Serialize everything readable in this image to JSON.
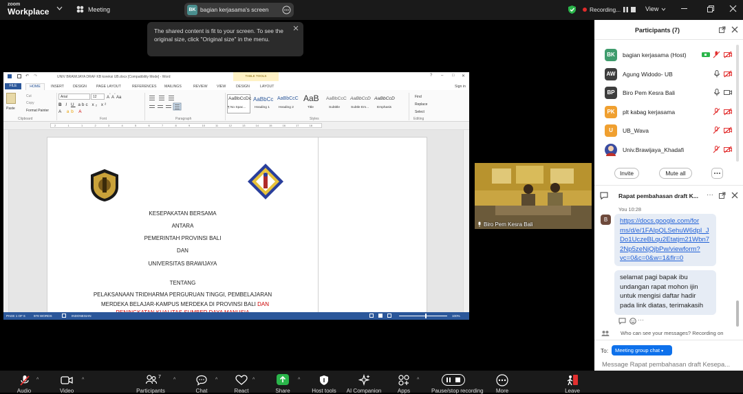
{
  "app": {
    "logo_line1": "zoom",
    "logo_line2": "Workplace",
    "meeting_label": "Meeting"
  },
  "share": {
    "avatar_initials": "BK",
    "label": "bagian kerjasama's screen"
  },
  "topbar": {
    "recording_label": "Recording...",
    "view_label": "View"
  },
  "tooltip": {
    "text": "The shared content is fit to your screen. To see the original size, click \"Original size\" in the menu."
  },
  "word": {
    "title": "UNIV BRAWIJAYA DRAF KB koreksi UB.docx [Compatibility Mode] - Word",
    "table_tools": "TABLE TOOLS",
    "signin": "Sign in",
    "tabs": [
      "FILE",
      "HOME",
      "INSERT",
      "DESIGN",
      "PAGE LAYOUT",
      "REFERENCES",
      "MAILINGS",
      "REVIEW",
      "VIEW",
      "DESIGN",
      "LAYOUT"
    ],
    "clipboard": {
      "paste": "Paste",
      "cut": "Cut",
      "copy": "Copy",
      "format_painter": "Format Painter",
      "group": "Clipboard"
    },
    "font": {
      "name": "Arial",
      "size": "12",
      "group": "Font"
    },
    "paragraph_group": "Paragraph",
    "styles": [
      {
        "preview": "AaBbCcDc",
        "name": "¶ No Spac..."
      },
      {
        "preview": "AaBbCc",
        "name": "Heading 1"
      },
      {
        "preview": "AaBbCcC",
        "name": "Heading 2"
      },
      {
        "preview": "AaB",
        "name": "Title"
      },
      {
        "preview": "AaBbCcC",
        "name": "Subtitle"
      },
      {
        "preview": "AaBbCcD",
        "name": "Subtle Em..."
      },
      {
        "preview": "AaBbCcD",
        "name": "Emphasis"
      }
    ],
    "styles_group": "Styles",
    "editing": {
      "find": "Find",
      "replace": "Replace",
      "select": "Select",
      "group": "Editing"
    },
    "ruler_numbers": [
      "2",
      "1",
      "1",
      "2",
      "3",
      "4",
      "5",
      "6",
      "7",
      "8",
      "9",
      "10",
      "11",
      "12",
      "13",
      "14",
      "15",
      "16",
      "17",
      "18"
    ],
    "doc_lines": [
      "KESEPAKATAN BERSAMA",
      "ANTARA",
      "PEMERINTAH PROVINSI BALI",
      "DAN",
      "UNIVERSITAS BRAWIJAYA",
      "TENTANG",
      "PELAKSANAAN TRIDHARMA PERGURUAN TINGGI, PEMBELAJARAN",
      "MERDEKA BELAJAR-KAMPUS MERDEKA DI PROVINSI BALI"
    ],
    "doc_red_1": "DAN",
    "doc_red_2": "PENINGKATAN KUALITAS SUMBER DAYA MANUSIA",
    "status": {
      "page": "PAGE 1 OF 6",
      "words": "978 WORDS",
      "language": "INDONESIAN",
      "zoom": "100%"
    }
  },
  "video": {
    "name": "Biro Pem Kesra Bali"
  },
  "participants": {
    "title": "Participants (7)",
    "list": [
      {
        "initials": "BK",
        "name": "bagian kerjasama (Host)",
        "color": "#3f9c6d"
      },
      {
        "initials": "AW",
        "name": "Agung Widodo- UB",
        "color": "#3d3d3d"
      },
      {
        "initials": "BP",
        "name": "Biro Pem Kesra Bali",
        "color": "#3d3d3d"
      },
      {
        "initials": "PK",
        "name": "plt kabag kerjasama",
        "color": "#f0a030"
      },
      {
        "initials": "U",
        "name": "UB_Wava",
        "color": "#f0a030"
      },
      {
        "initials": "",
        "name": "Univ.Brawijaya_Khadafi",
        "color": "#3a4ca0"
      }
    ],
    "invite": "Invite",
    "mute_all": "Mute all"
  },
  "chat": {
    "title": "Rapat pembahasan draft K...",
    "sender_initial": "B",
    "meta": "You 10:28",
    "link_text": "https://docs.google.com/forms/d/e/1FAIpQLSehuW6dpI_JDo1UczeBLqu2Etatjm21Wbn72Np5zeNjQjbPw/viewform?vc=0&c=0&w=1&flr=0",
    "link_lines": [
      "https://docs.google.com/for",
      "ms/d/e/1FAIpQLSehuW6dpI_J",
      "Do1UczeBLqu2Etatjm21Wbn7",
      "2Np5zeNjQjbPw/viewform?",
      "vc=0&c=0&w=1&flr=0"
    ],
    "message_lines": [
      "selamat pagi bapak ibu",
      "undangan rapat mohon ijin",
      "untuk mengisi daftar hadir",
      "pada link diatas, terimakasih"
    ],
    "notice": "Who can see your messages? Recording on",
    "to_label": "To:",
    "recipient": "Meeting group chat",
    "input_placeholder": "Message Rapat pembahasan draft Kesepa..."
  },
  "toolbar": [
    {
      "label": "Audio"
    },
    {
      "label": "Video"
    },
    {
      "label": "Participants",
      "count": "7"
    },
    {
      "label": "Chat"
    },
    {
      "label": "React"
    },
    {
      "label": "Share"
    },
    {
      "label": "Host tools"
    },
    {
      "label": "AI Companion"
    },
    {
      "label": "Apps"
    },
    {
      "label": "Pause/stop recording"
    },
    {
      "label": "More"
    },
    {
      "label": "Leave"
    }
  ]
}
